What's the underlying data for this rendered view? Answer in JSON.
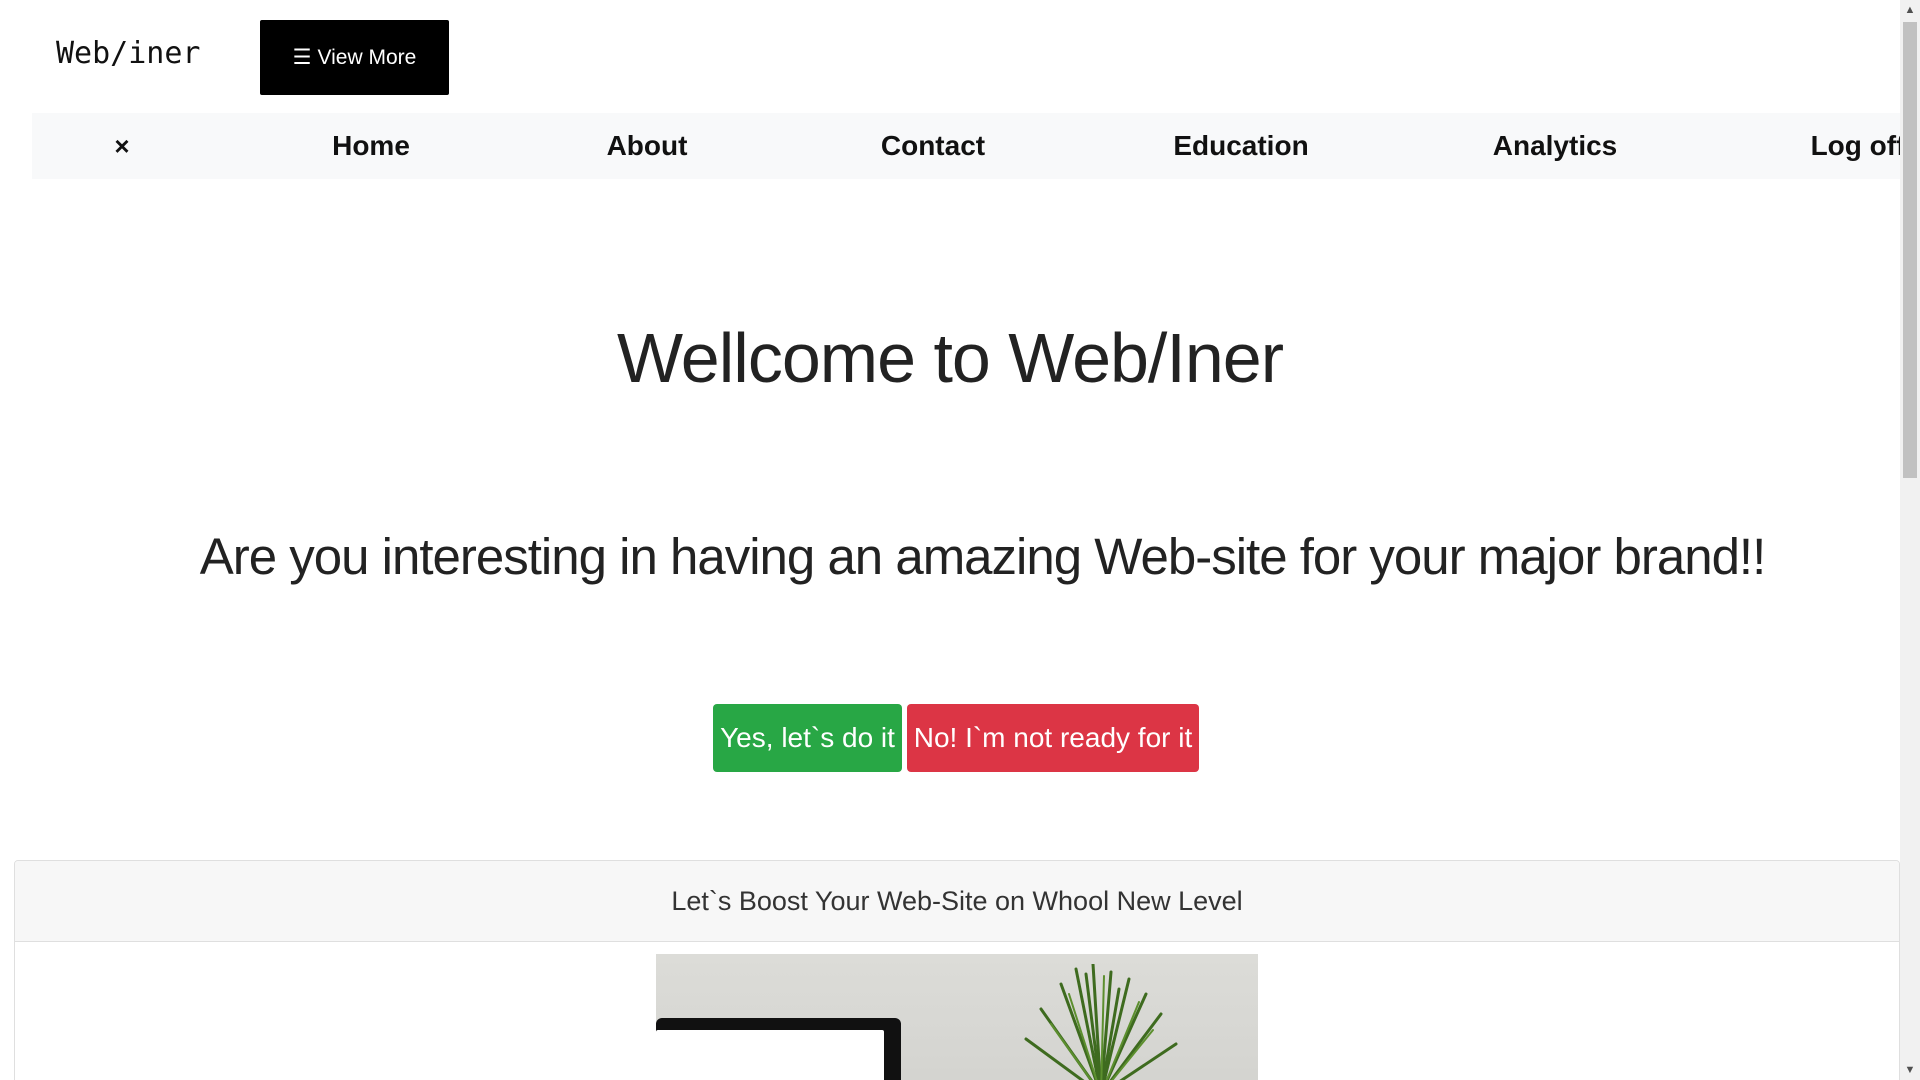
{
  "header": {
    "brand": "Web/iner",
    "view_more_icon": "☰",
    "view_more_label": "View More"
  },
  "nav": {
    "close_icon": "×",
    "items": [
      {
        "label": "Home"
      },
      {
        "label": "About"
      },
      {
        "label": "Contact"
      },
      {
        "label": "Education"
      },
      {
        "label": "Analytics"
      },
      {
        "label": "Log off"
      }
    ]
  },
  "hero": {
    "title": "Wellcome to Web/Iner",
    "subtitle": "Are you interesting in having an amazing Web-site for your major brand!!",
    "yes_label": "Yes, let`s do it",
    "no_label": "No! I`m not ready for it"
  },
  "card": {
    "header": "Let`s Boost Your Web-Site on Whool New Level"
  },
  "colors": {
    "success": "#28a745",
    "danger": "#dc3545",
    "navbar_bg": "#f8f9fa",
    "view_more_bg": "#000000"
  },
  "scrollbar": {
    "up_icon": "▲",
    "down_icon": "▼"
  }
}
